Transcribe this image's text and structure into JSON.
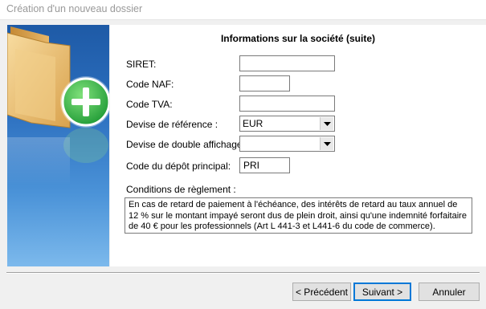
{
  "window": {
    "title": "Création d'un nouveau dossier"
  },
  "page": {
    "heading": "Informations sur la société (suite)"
  },
  "form": {
    "siret": {
      "label": "SIRET:",
      "value": ""
    },
    "naf": {
      "label": "Code NAF:",
      "value": ""
    },
    "tva": {
      "label": "Code TVA:",
      "value": ""
    },
    "devise_reference": {
      "label": "Devise de référence :",
      "value": "EUR"
    },
    "devise_double": {
      "label": "Devise de double affichage :",
      "value": ""
    },
    "depot": {
      "label": "Code du dépôt principal:",
      "value": "PRI"
    },
    "conditions": {
      "label": "Conditions de règlement :",
      "text": "En cas de retard de paiement à l'échéance, des intérêts de retard au taux annuel de 12 % sur le montant impayé seront dus de plein droit, ainsi qu'une indemnité forfaitaire de 40 € pour les professionnels (Art L 441-3 et L441-6 du code de commerce)."
    }
  },
  "buttons": {
    "previous": "< Précédent",
    "next": "Suivant >",
    "cancel": "Annuler"
  },
  "icons": {
    "banner": "folder-add-icon",
    "dropdown": "chevron-down-icon"
  },
  "colors": {
    "banner_top": "#1e5aa6",
    "banner_bottom": "#7cb9ec",
    "plus_green": "#2fb34a",
    "default_button_border": "#0078d7"
  }
}
